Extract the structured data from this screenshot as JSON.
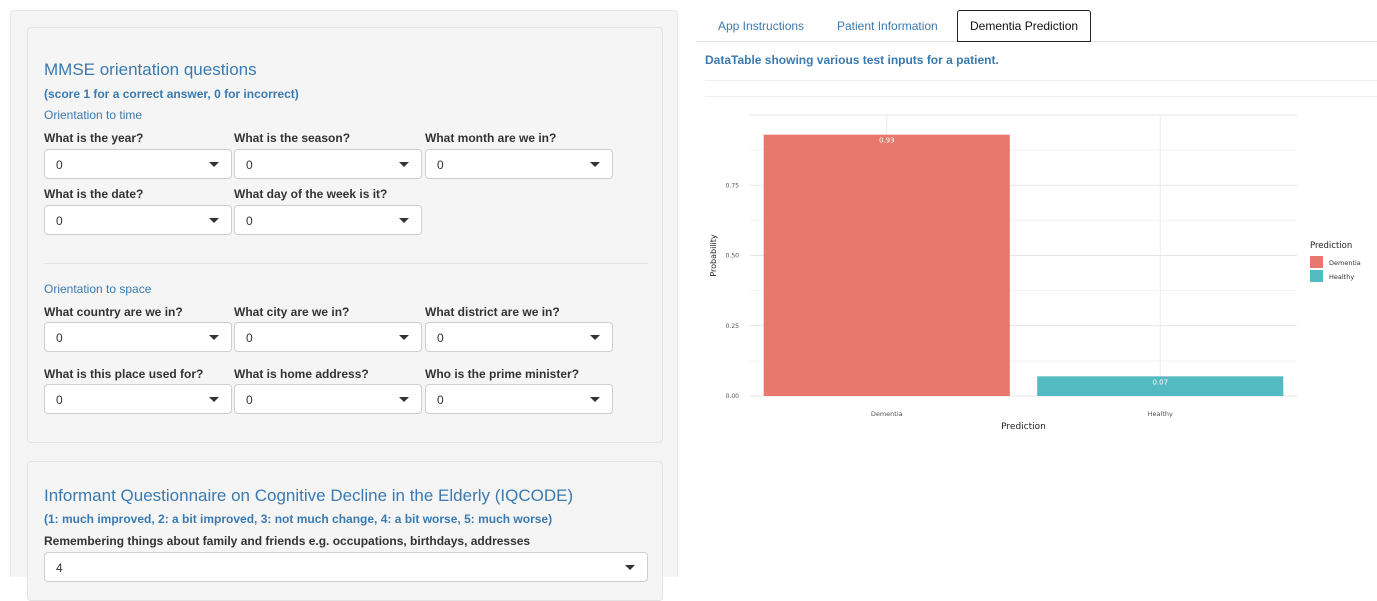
{
  "mmse": {
    "title": "MMSE orientation questions",
    "subtitle": "(score 1 for a correct answer, 0 for incorrect)",
    "time_section": "Orientation to time",
    "time_questions": [
      {
        "label": "What is the year?",
        "value": "0"
      },
      {
        "label": "What is the season?",
        "value": "0"
      },
      {
        "label": "What month are we in?",
        "value": "0"
      },
      {
        "label": "What is the date?",
        "value": "0"
      },
      {
        "label": "What day of the week is it?",
        "value": "0"
      }
    ],
    "space_section": "Orientation to space",
    "space_questions": [
      {
        "label": "What country are we in?",
        "value": "0"
      },
      {
        "label": "What city are we in?",
        "value": "0"
      },
      {
        "label": "What district are we in?",
        "value": "0"
      },
      {
        "label": "What is this place used for?",
        "value": "0"
      },
      {
        "label": "What is home address?",
        "value": "0"
      },
      {
        "label": "Who is the prime minister?",
        "value": "0"
      }
    ]
  },
  "iqcode": {
    "title": "Informant Questionnaire on Cognitive Decline in the Elderly (IQCODE)",
    "subtitle": "(1: much improved, 2: a bit improved, 3: not much change, 4: a bit worse, 5: much worse)",
    "questions": [
      {
        "label": "Remembering things about family and friends e.g. occupations, birthdays, addresses",
        "value": "4"
      }
    ]
  },
  "tabs": [
    {
      "label": "App Instructions"
    },
    {
      "label": "Patient Information"
    },
    {
      "label": "Dementia Prediction",
      "active": true
    }
  ],
  "main": {
    "caption": "DataTable showing various test inputs for a patient."
  },
  "colors": {
    "accent": "#3a7ab0",
    "dementia": "#E8776D",
    "healthy": "#54BBC3"
  },
  "chart_data": {
    "type": "bar",
    "categories": [
      "Dementia",
      "Healthy"
    ],
    "values": [
      0.93,
      0.07
    ],
    "data_labels": [
      "0.93",
      "0.07"
    ],
    "xlabel": "Prediction",
    "ylabel": "Probability",
    "ylim": [
      0,
      1
    ],
    "yticks": [
      "0.00",
      "0.25",
      "0.50",
      "0.75"
    ],
    "grid": true,
    "legend": {
      "title": "Prediction",
      "placement": "right",
      "entries": [
        {
          "name": "Dementia",
          "color": "#E8776D"
        },
        {
          "name": "Healthy",
          "color": "#54BBC3"
        }
      ]
    }
  }
}
